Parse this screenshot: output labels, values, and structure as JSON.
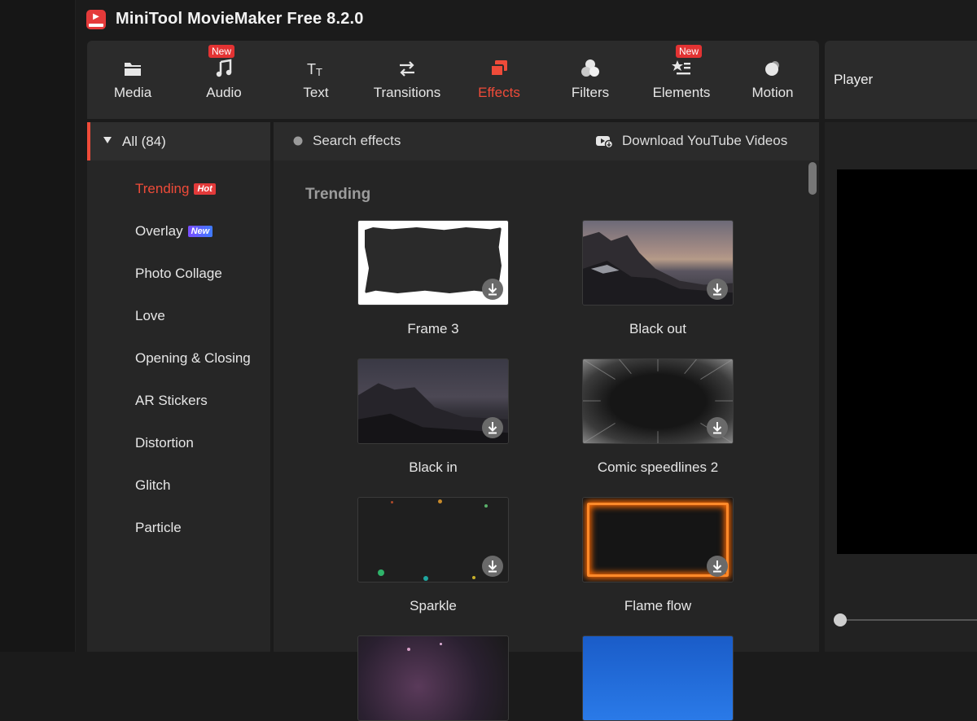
{
  "app": {
    "title": "MiniTool MovieMaker Free 8.2.0"
  },
  "toolbar": {
    "items": [
      {
        "label": "Media",
        "icon": "folder-icon",
        "badge": ""
      },
      {
        "label": "Audio",
        "icon": "music-note-icon",
        "badge": "New"
      },
      {
        "label": "Text",
        "icon": "text-icon",
        "badge": ""
      },
      {
        "label": "Transitions",
        "icon": "swap-arrows-icon",
        "badge": ""
      },
      {
        "label": "Effects",
        "icon": "effects-icon",
        "badge": ""
      },
      {
        "label": "Filters",
        "icon": "filters-icon",
        "badge": ""
      },
      {
        "label": "Elements",
        "icon": "elements-icon",
        "badge": "New"
      },
      {
        "label": "Motion",
        "icon": "motion-icon",
        "badge": ""
      }
    ],
    "active": "Effects",
    "accent_color": "#ef4b39"
  },
  "player": {
    "title": "Player"
  },
  "sidebar": {
    "all_label": "All (84)",
    "categories": [
      {
        "label": "Trending",
        "tag": "Hot"
      },
      {
        "label": "Overlay",
        "tag": "New"
      },
      {
        "label": "Photo Collage",
        "tag": ""
      },
      {
        "label": "Love",
        "tag": ""
      },
      {
        "label": "Opening & Closing",
        "tag": ""
      },
      {
        "label": "AR Stickers",
        "tag": ""
      },
      {
        "label": "Distortion",
        "tag": ""
      },
      {
        "label": "Glitch",
        "tag": ""
      },
      {
        "label": "Particle",
        "tag": ""
      }
    ]
  },
  "content": {
    "search_placeholder": "Search effects",
    "download_link": "Download YouTube Videos",
    "section_title": "Trending",
    "effects": [
      {
        "label": "Frame 3",
        "thumb": "frame"
      },
      {
        "label": "Black out",
        "thumb": "mountain-a"
      },
      {
        "label": "Black in",
        "thumb": "mountain-b"
      },
      {
        "label": "Comic speedlines 2",
        "thumb": "speed"
      },
      {
        "label": "Sparkle",
        "thumb": "sparkle"
      },
      {
        "label": "Flame flow",
        "thumb": "flame"
      },
      {
        "label": "",
        "thumb": "bokeh"
      },
      {
        "label": "",
        "thumb": "blue"
      }
    ]
  }
}
